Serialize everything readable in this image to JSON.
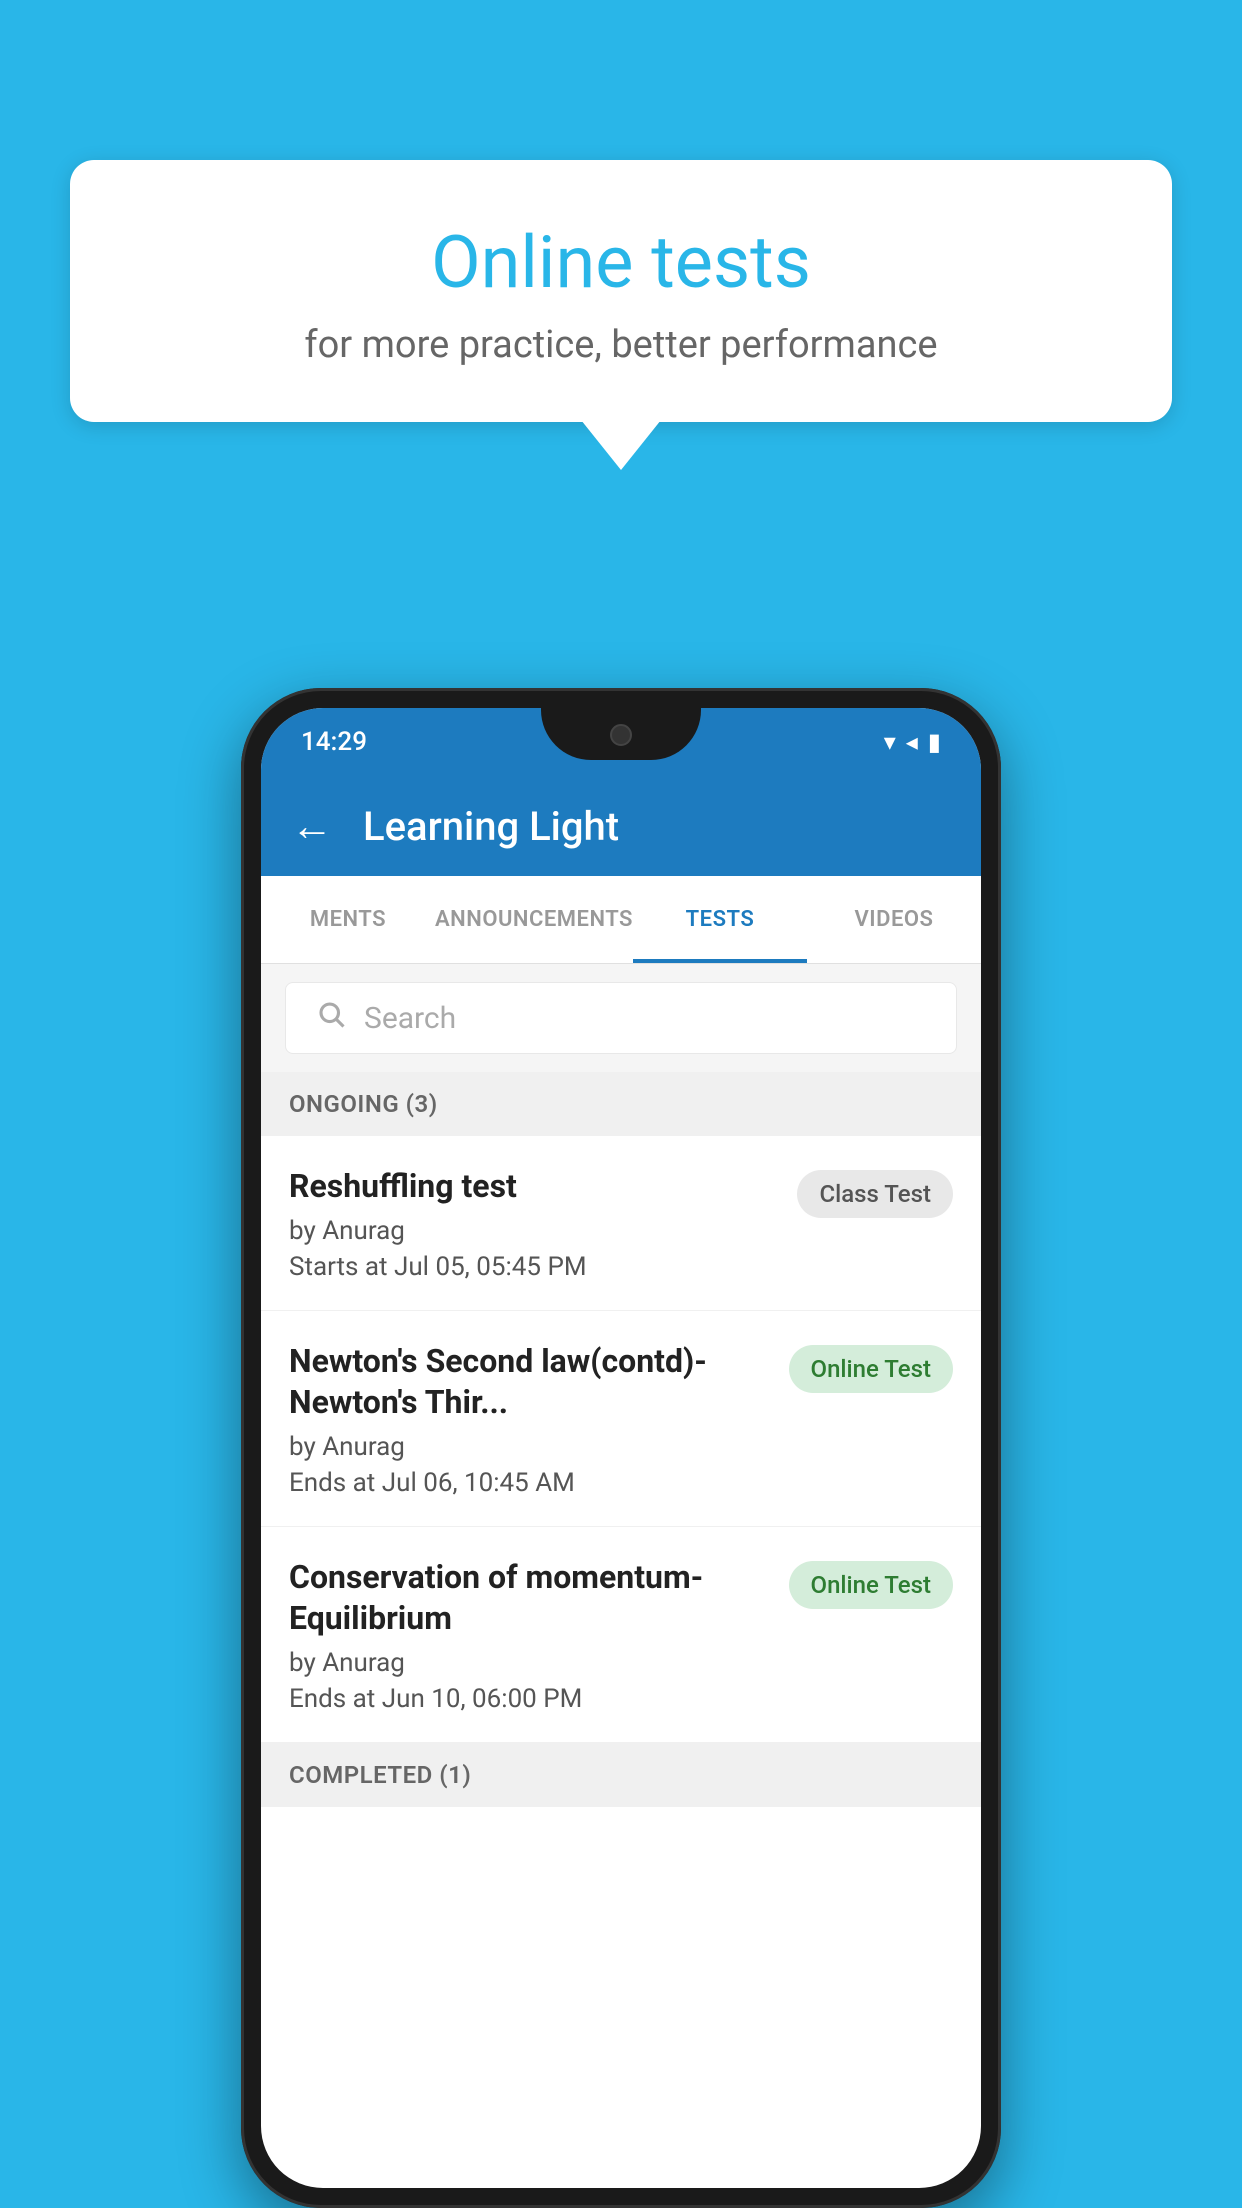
{
  "background_color": "#29b6e8",
  "speech_bubble": {
    "title": "Online tests",
    "subtitle": "for more practice, better performance"
  },
  "phone": {
    "status_bar": {
      "time": "14:29",
      "wifi_icon": "▼",
      "signal_icon": "◀",
      "battery_icon": "▮"
    },
    "app_bar": {
      "back_label": "←",
      "title": "Learning Light"
    },
    "tabs": [
      {
        "label": "MENTS",
        "active": false
      },
      {
        "label": "ANNOUNCEMENTS",
        "active": false
      },
      {
        "label": "TESTS",
        "active": true
      },
      {
        "label": "VIDEOS",
        "active": false
      }
    ],
    "search": {
      "placeholder": "Search"
    },
    "ongoing_section": {
      "title": "ONGOING (3)",
      "tests": [
        {
          "name": "Reshuffling test",
          "author": "by Anurag",
          "time_label": "Starts at  Jul 05, 05:45 PM",
          "badge": "Class Test",
          "badge_type": "class"
        },
        {
          "name": "Newton's Second law(contd)-Newton's Thir...",
          "author": "by Anurag",
          "time_label": "Ends at  Jul 06, 10:45 AM",
          "badge": "Online Test",
          "badge_type": "online"
        },
        {
          "name": "Conservation of momentum-Equilibrium",
          "author": "by Anurag",
          "time_label": "Ends at  Jun 10, 06:00 PM",
          "badge": "Online Test",
          "badge_type": "online"
        }
      ]
    },
    "completed_section": {
      "title": "COMPLETED (1)"
    }
  }
}
